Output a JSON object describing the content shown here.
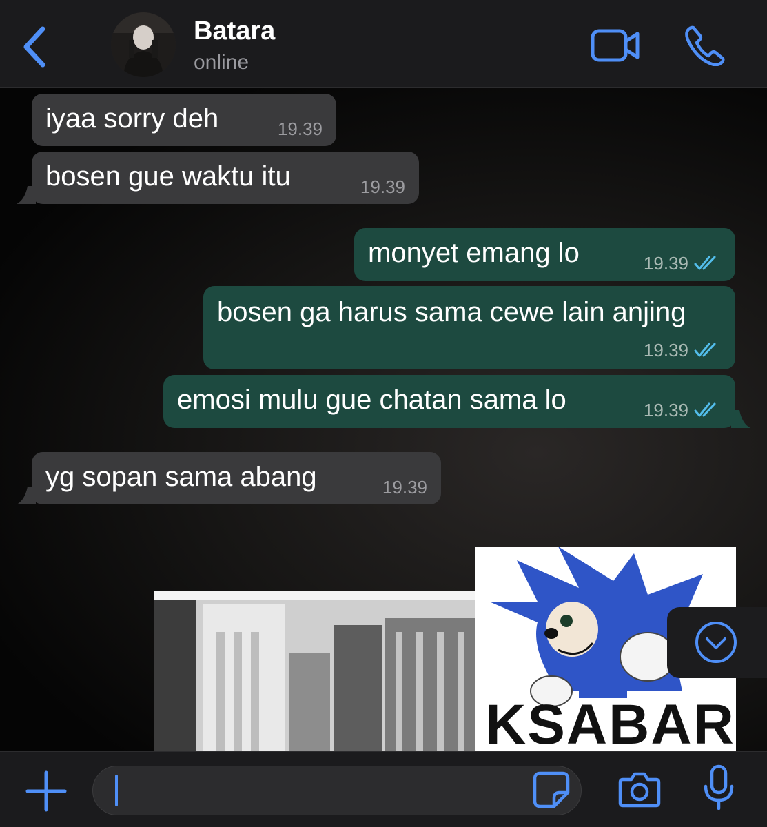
{
  "header": {
    "contact_name": "Batara",
    "status": "online"
  },
  "messages": [
    {
      "direction": "incoming",
      "text": "iyaa sorry deh",
      "time": "19.39"
    },
    {
      "direction": "incoming",
      "text": "bosen gue waktu itu",
      "time": "19.39"
    },
    {
      "direction": "outgoing",
      "text": "monyet emang lo",
      "time": "19.39",
      "status": "read"
    },
    {
      "direction": "outgoing",
      "text": "bosen ga harus sama cewe lain anjing",
      "time": "19.39",
      "status": "read"
    },
    {
      "direction": "outgoing",
      "text": "emosi mulu gue chatan sama lo",
      "time": "19.39",
      "status": "read"
    },
    {
      "direction": "incoming",
      "text": "yg sopan sama abang",
      "time": "19.39"
    }
  ],
  "media": {
    "meme_caption": "KSABAR"
  },
  "colors": {
    "accent": "#4f8ff7",
    "incoming_bubble": "#3a3a3c",
    "outgoing_bubble": "#1d4a40",
    "read_ticks": "#53bdeb"
  },
  "icons": [
    "back-chevron-icon",
    "video-camera-icon",
    "phone-icon",
    "chevron-down-icon",
    "plus-icon",
    "sticker-icon",
    "camera-icon",
    "microphone-icon"
  ]
}
